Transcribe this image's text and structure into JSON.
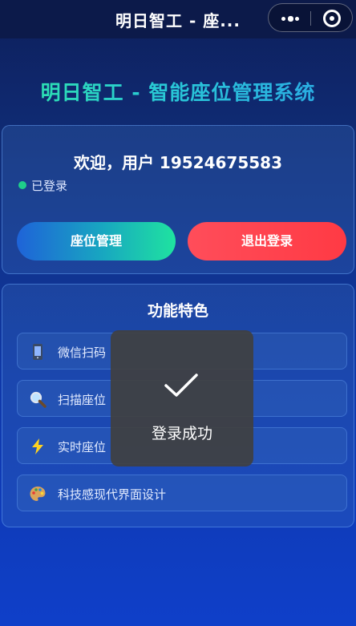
{
  "navbar": {
    "title": "明日智工 - 座...",
    "more_icon": "more-dots-icon",
    "close_icon": "circle-close-icon"
  },
  "app_title": "明日智工 - 智能座位管理系统",
  "welcome": {
    "text": "欢迎，用户 19524675583",
    "status": "已登录",
    "status_color": "#1fcf8a"
  },
  "buttons": {
    "seat_management": "座位管理",
    "logout": "退出登录"
  },
  "features": {
    "title": "功能特色",
    "items": [
      {
        "icon": "phone-icon",
        "label": "微信扫码"
      },
      {
        "icon": "magnifier-icon",
        "label": "扫描座位"
      },
      {
        "icon": "lightning-icon",
        "label": "实时座位"
      },
      {
        "icon": "palette-icon",
        "label": "科技感现代界面设计"
      }
    ]
  },
  "toast": {
    "icon": "checkmark-icon",
    "message": "登录成功"
  },
  "colors": {
    "accent_green": "#1fe3a0",
    "accent_blue": "#1e63d8",
    "danger_red": "#ff4d5a"
  }
}
